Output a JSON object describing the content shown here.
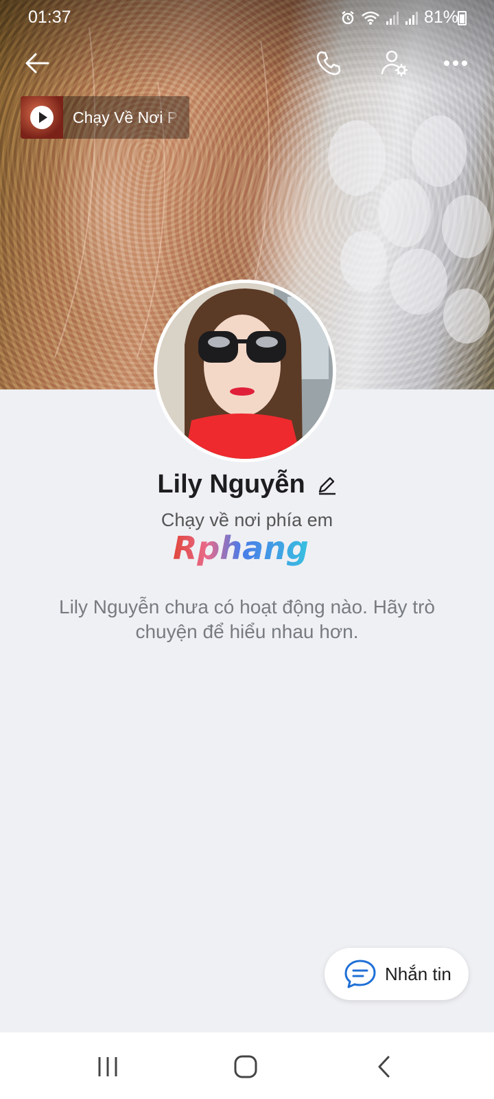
{
  "status_bar": {
    "time": "01:37",
    "battery": "81%",
    "icons": [
      "alarm-icon",
      "wifi-icon",
      "signal-icon",
      "signal-icon",
      "battery-icon"
    ]
  },
  "header": {
    "back_icon": "arrow-left-icon",
    "call_icon": "phone-icon",
    "settings_icon": "user-settings-icon",
    "more_icon": "more-dots-icon"
  },
  "music": {
    "title": "Chạy Về Nơi Phía Em",
    "play_icon": "play-icon"
  },
  "profile": {
    "name": "Lily Nguyễn",
    "bio": "Chạy về nơi phía em",
    "edit_icon": "pencil-icon"
  },
  "watermark": {
    "text": "Rphang"
  },
  "timeline": {
    "empty_message": "Lily Nguyễn chưa có hoạt động nào. Hãy trò chuyện để hiểu nhau hơn."
  },
  "fab": {
    "label": "Nhắn tin",
    "icon": "chat-bubble-icon",
    "accent": "#0068ff"
  },
  "system_nav": {
    "icons": [
      "recents-icon",
      "home-icon",
      "back-chevron-icon"
    ]
  }
}
